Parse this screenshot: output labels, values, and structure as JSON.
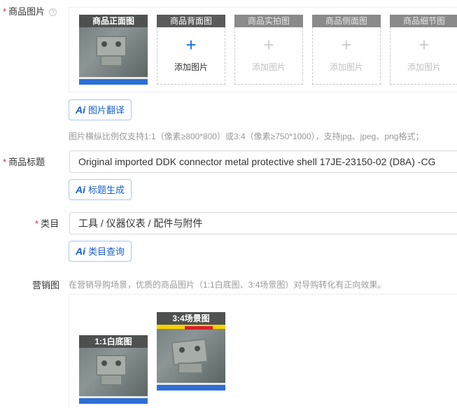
{
  "product_images": {
    "label": "商品图片",
    "required_mark": "*",
    "help_icon": "question-circle-icon",
    "slots": [
      {
        "title": "商品正面图",
        "filled": true
      },
      {
        "title": "商品背面图",
        "filled": false,
        "add_label": "添加图片",
        "enabled": true
      },
      {
        "title": "商品实拍图",
        "filled": false,
        "add_label": "添加图片",
        "enabled": false
      },
      {
        "title": "商品侧面图",
        "filled": false,
        "add_label": "添加图片",
        "enabled": false
      },
      {
        "title": "商品细节图",
        "filled": false,
        "add_label": "添加图片",
        "enabled": false
      }
    ],
    "translate_button": "图片翻译",
    "ai_icon_text": "Ai",
    "hint": "图片横纵比例仅支持1:1（像素≥800*800）或3:4（像素≥750*1000），支持jpg、jpeg、png格式；"
  },
  "product_title": {
    "label": "商品标题",
    "required_mark": "*",
    "value": "Original imported DDK connector metal protective shell 17JE-23150-02 (D8A) -CG",
    "generate_button": "标题生成"
  },
  "category": {
    "label": "类目",
    "required_mark": "*",
    "value": "工具 / 仪器仪表 / 配件与附件",
    "query_button": "类目查询"
  },
  "marketing": {
    "label": "营销图",
    "hint": "在营销导购场景，优质的商品图片（1:1白底图、3:4场景图）对导购转化有正向效果。",
    "images": [
      {
        "title": "1:1白底图"
      },
      {
        "title": "3:4场景图"
      }
    ]
  },
  "colors": {
    "accent": "#1a5fd0",
    "required": "#f5222d",
    "hint_text": "#999999",
    "slot_header": "#5a5a5a"
  }
}
